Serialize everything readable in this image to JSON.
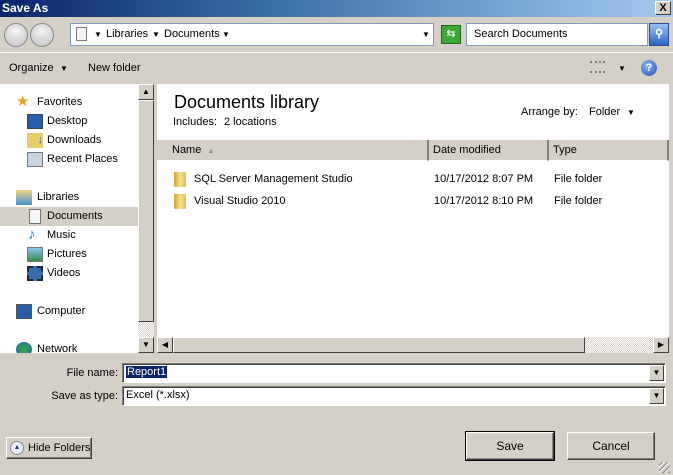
{
  "window": {
    "title": "Save As",
    "close": "X"
  },
  "address": {
    "crumbs": [
      "Libraries",
      "Documents"
    ],
    "search_placeholder": "Search Documents"
  },
  "toolbar": {
    "organize": "Organize",
    "new_folder": "New folder"
  },
  "nav": {
    "items": [
      {
        "label": "Favorites",
        "icon": "star-icon"
      },
      {
        "label": "Desktop",
        "icon": "desktop-icon"
      },
      {
        "label": "Downloads",
        "icon": "downloads-icon"
      },
      {
        "label": "Recent Places",
        "icon": "recent-places-icon"
      },
      {
        "label": "Libraries",
        "icon": "libraries-icon"
      },
      {
        "label": "Documents",
        "icon": "documents-icon",
        "selected": true
      },
      {
        "label": "Music",
        "icon": "music-icon"
      },
      {
        "label": "Pictures",
        "icon": "pictures-icon"
      },
      {
        "label": "Videos",
        "icon": "videos-icon"
      },
      {
        "label": "Computer",
        "icon": "computer-icon"
      },
      {
        "label": "Network",
        "icon": "network-icon"
      }
    ]
  },
  "main": {
    "title": "Documents library",
    "includes_label": "Includes:",
    "includes_value": "2 locations",
    "arrange_label": "Arrange by:",
    "arrange_value": "Folder",
    "columns": [
      "Name",
      "Date modified",
      "Type"
    ],
    "rows": [
      {
        "name": "SQL Server Management Studio",
        "date": "10/17/2012 8:07 PM",
        "type": "File folder"
      },
      {
        "name": "Visual Studio 2010",
        "date": "10/17/2012 8:10 PM",
        "type": "File folder"
      }
    ]
  },
  "form": {
    "file_name_label": "File name:",
    "file_name": "Report1",
    "type_label": "Save as type:",
    "type_value": "Excel (*.xlsx)"
  },
  "buttons": {
    "hide_folders": "Hide Folders",
    "save": "Save",
    "cancel": "Cancel"
  },
  "colors": {
    "selection": "#0a246a",
    "title_start": "#0a246a",
    "title_end": "#a6caf0"
  }
}
